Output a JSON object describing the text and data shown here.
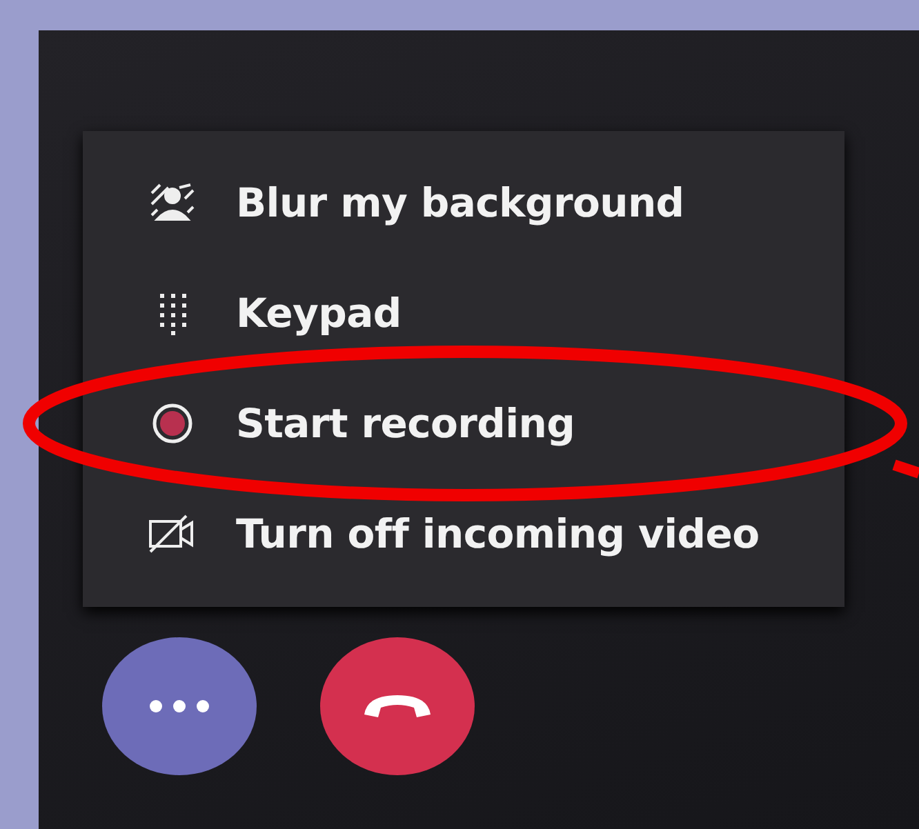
{
  "menu": {
    "items": [
      {
        "kind": "blur",
        "label": "Blur my background"
      },
      {
        "kind": "keypad",
        "label": "Keypad"
      },
      {
        "kind": "record",
        "label": "Start recording",
        "highlighted": true
      },
      {
        "kind": "video-off",
        "label": "Turn off incoming video"
      }
    ]
  },
  "call_controls": [
    {
      "kind": "more"
    },
    {
      "kind": "hang-up"
    }
  ]
}
